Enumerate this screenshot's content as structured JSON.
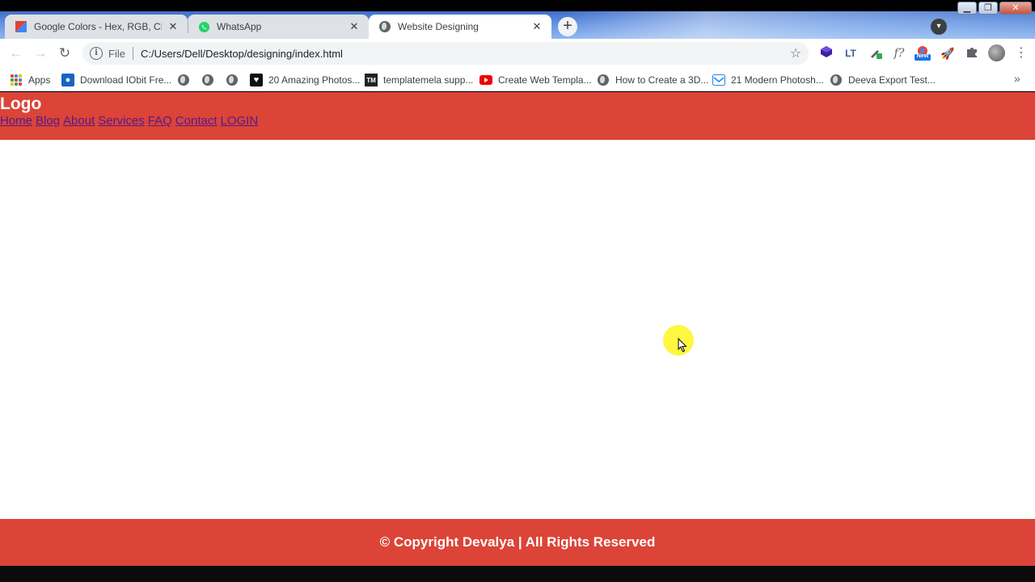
{
  "browser": {
    "tabs": [
      {
        "title": "Google Colors - Hex, RGB, CMYK",
        "favicon": "google-colors-icon",
        "active": false
      },
      {
        "title": "WhatsApp",
        "favicon": "whatsapp-icon",
        "active": false
      },
      {
        "title": "Website Designing",
        "favicon": "globe-icon",
        "active": true
      }
    ],
    "close_glyph": "✕",
    "new_tab_glyph": "+",
    "omnibox": {
      "scheme_label": "File",
      "url": "C:/Users/Dell/Desktop/designing/index.html"
    },
    "bookmarks": [
      {
        "label": "Apps",
        "icon": "apps-grid-icon"
      },
      {
        "label": "Download IObit Fre...",
        "icon": "iobit-icon"
      },
      {
        "label": "",
        "icon": "globe-icon"
      },
      {
        "label": "",
        "icon": "globe-icon"
      },
      {
        "label": "",
        "icon": "globe-icon"
      },
      {
        "label": "20 Amazing Photos...",
        "icon": "bookmark-site-icon"
      },
      {
        "label": "templatemela supp...",
        "icon": "templatemela-icon"
      },
      {
        "label": "Create Web Templa...",
        "icon": "youtube-icon"
      },
      {
        "label": "How to Create a 3D...",
        "icon": "globe-icon"
      },
      {
        "label": "21 Modern Photosh...",
        "icon": "mail-icon"
      },
      {
        "label": "Deeva Export Test...",
        "icon": "globe-icon"
      }
    ],
    "extension_new_badge": "New"
  },
  "site": {
    "logo": "Logo",
    "nav": [
      "Home",
      "Blog",
      "About",
      "Services",
      "FAQ",
      "Contact",
      "LOGIN"
    ],
    "footer": "© Copyright Devalya | All Rights Reserved"
  },
  "colors": {
    "header_bg": "#db4437",
    "footer_bg": "#db4437",
    "nav_link": "#551a8b",
    "cursor_highlight": "#fff400"
  }
}
